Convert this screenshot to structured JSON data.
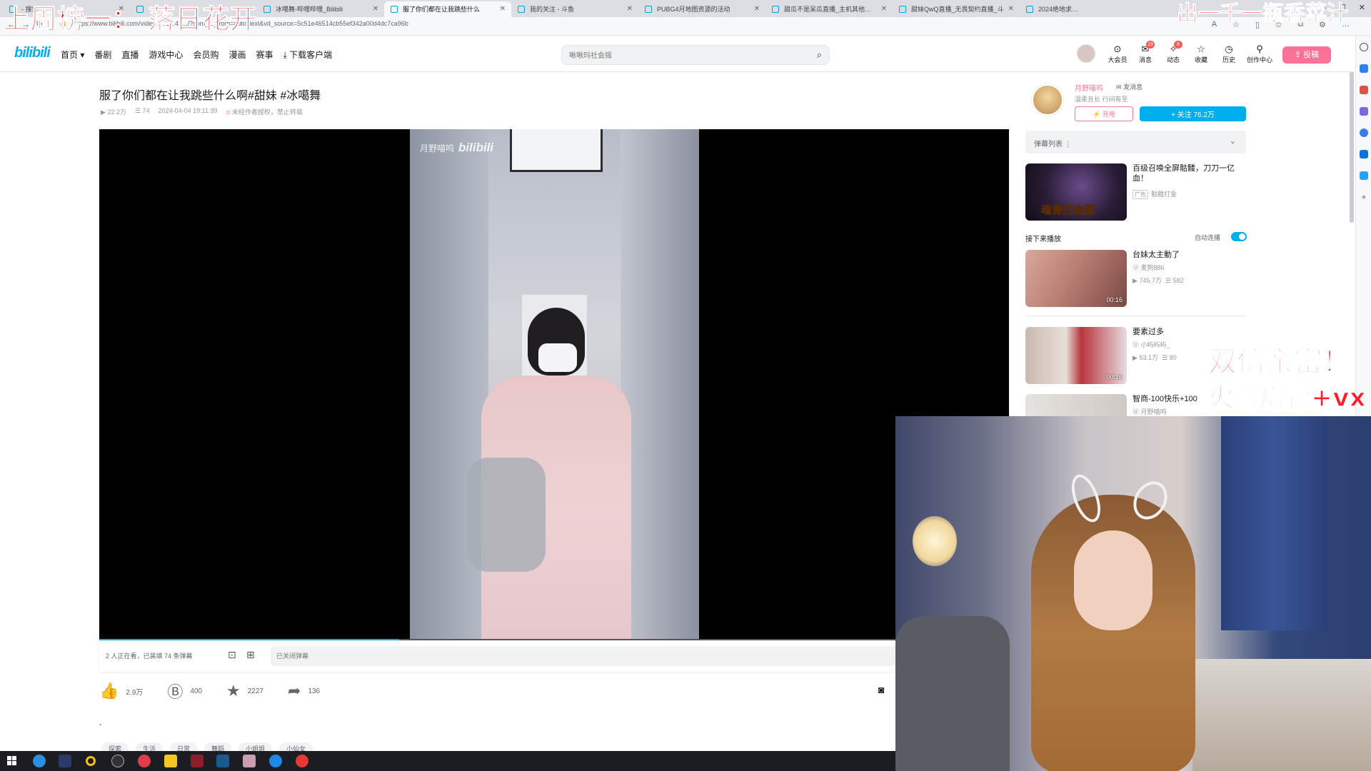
{
  "browser": {
    "tabs": [
      {
        "title": "- 搜索",
        "active": false
      },
      {
        "title": "",
        "active": false
      },
      {
        "title": "冰噶舞-哔哩哔哩_Bilibili",
        "active": false
      },
      {
        "title": "服了你们都在让我跳些什么",
        "active": true
      },
      {
        "title": "我的关注 - 斗鱼",
        "active": false
      },
      {
        "title": "PUBG4月地图资源的活动",
        "active": false
      },
      {
        "title": "甜瓜不是呆瓜直播_主机其他游戏",
        "active": false
      },
      {
        "title": "甜妹QwQ直播_无畏契约直播_斗",
        "active": false
      },
      {
        "title": "2024绝地求生中",
        "active": false
      }
    ],
    "url": "https://www.bilibili.com/video/BV1...42.../?spm_id_from=autoNext&vd_source=5c51e46514cb55ef342a00d4dc7ca96b"
  },
  "header": {
    "logo": "bilibili",
    "nav": [
      "首页",
      "番剧",
      "直播",
      "游戏中心",
      "会员购",
      "漫画",
      "赛事",
      "下载客户端"
    ],
    "search_placeholder": "啾啾玛社会摇",
    "items": [
      {
        "label": "大会员",
        "icon": "vip-icon",
        "badge": ""
      },
      {
        "label": "消息",
        "icon": "message-icon",
        "badge": "19"
      },
      {
        "label": "动态",
        "icon": "dynamic-icon",
        "badge": "8"
      },
      {
        "label": "收藏",
        "icon": "favorite-icon",
        "badge": ""
      },
      {
        "label": "历史",
        "icon": "history-icon",
        "badge": ""
      },
      {
        "label": "创作中心",
        "icon": "creator-icon",
        "badge": ""
      }
    ],
    "upload": "投稿"
  },
  "video": {
    "title": "服了你们都在让我跳些什么啊#甜妹 #冰噶舞",
    "views": "22.2万",
    "danmaku_count": "74",
    "datetime": "2024-04-04 19:11:39",
    "copyright": "未经作者授权，禁止转载",
    "watermark_name": "月野喵呜",
    "watermark_logo": "bilibili",
    "progress": 0.33
  },
  "danmaku_bar": {
    "viewers": "2 人正在看，已装填 74 条弹幕",
    "input_placeholder": "已关闭弹幕"
  },
  "actions": {
    "like": "2.9万",
    "coin": "400",
    "favorite": "2227",
    "share": "136"
  },
  "description": "-",
  "tags": [
    "探索",
    "生活",
    "日常",
    "舞蹈",
    "小姐姐",
    "小仙女"
  ],
  "up": {
    "name": "月野喵呜",
    "message": "发消息",
    "sign": "温柔且长 行间有至",
    "charge": "充电",
    "follow": "+ 关注 76.2万"
  },
  "danmaku_list": {
    "label": "弹幕列表",
    "more": "⋮"
  },
  "ad": {
    "title": "百级召唤全屏骷髅，刀刀一亿血！",
    "ad_tag": "广告",
    "source": "骷髅打金",
    "thumb_text": "魂骨打金服"
  },
  "next": {
    "label": "接下来播放",
    "autoplay": "自动连播"
  },
  "recommendations": [
    {
      "title": "台妹太主動了",
      "uploader": "麦狗886",
      "views": "745.7万",
      "danmaku": "582",
      "duration": "00:16"
    },
    {
      "title": "要素过多",
      "uploader": "小屿屿屿_",
      "views": "53.1万",
      "danmaku": "80",
      "duration": "00:16"
    },
    {
      "title": "智商-100快乐+100",
      "uploader": "月野喵呜",
      "views": "",
      "danmaku": "",
      "duration": ""
    }
  ],
  "overlay": {
    "top_left": "上周榜一： 落日花开",
    "top_right": "出一千一瓶香菜汁",
    "mid_line1": "双倍亲密！",
    "mid_line2": "火箭房管+vx"
  }
}
